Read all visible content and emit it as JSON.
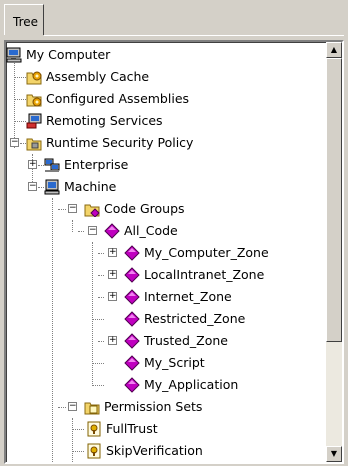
{
  "tab": {
    "label": "Tree"
  },
  "tree": {
    "my_computer": "My Computer",
    "assembly_cache": "Assembly Cache",
    "configured_assemblies": "Configured Assemblies",
    "remoting_services": "Remoting Services",
    "runtime_security_policy": "Runtime Security Policy",
    "enterprise": "Enterprise",
    "machine": "Machine",
    "code_groups": "Code Groups",
    "all_code": "All_Code",
    "my_computer_zone": "My_Computer_Zone",
    "localintranet_zone": "LocalIntranet_Zone",
    "internet_zone": "Internet_Zone",
    "restricted_zone": "Restricted_Zone",
    "trusted_zone": "Trusted_Zone",
    "my_script": "My_Script",
    "my_application": "My_Application",
    "permission_sets": "Permission Sets",
    "fulltrust": "FullTrust",
    "skipverification": "SkipVerification"
  },
  "icons": {
    "computer": "computer-icon",
    "gear_folder": "gear-folder-icon",
    "folder": "folder-icon",
    "remoting": "remoting-icon",
    "enterprise": "enterprise-icon",
    "machine": "machine-icon",
    "code_group": "diamond-icon",
    "permission": "permission-icon"
  },
  "expanders": {
    "plus": "+",
    "minus": "−"
  },
  "scrollbar": {
    "up": "▲",
    "down": "▼"
  }
}
